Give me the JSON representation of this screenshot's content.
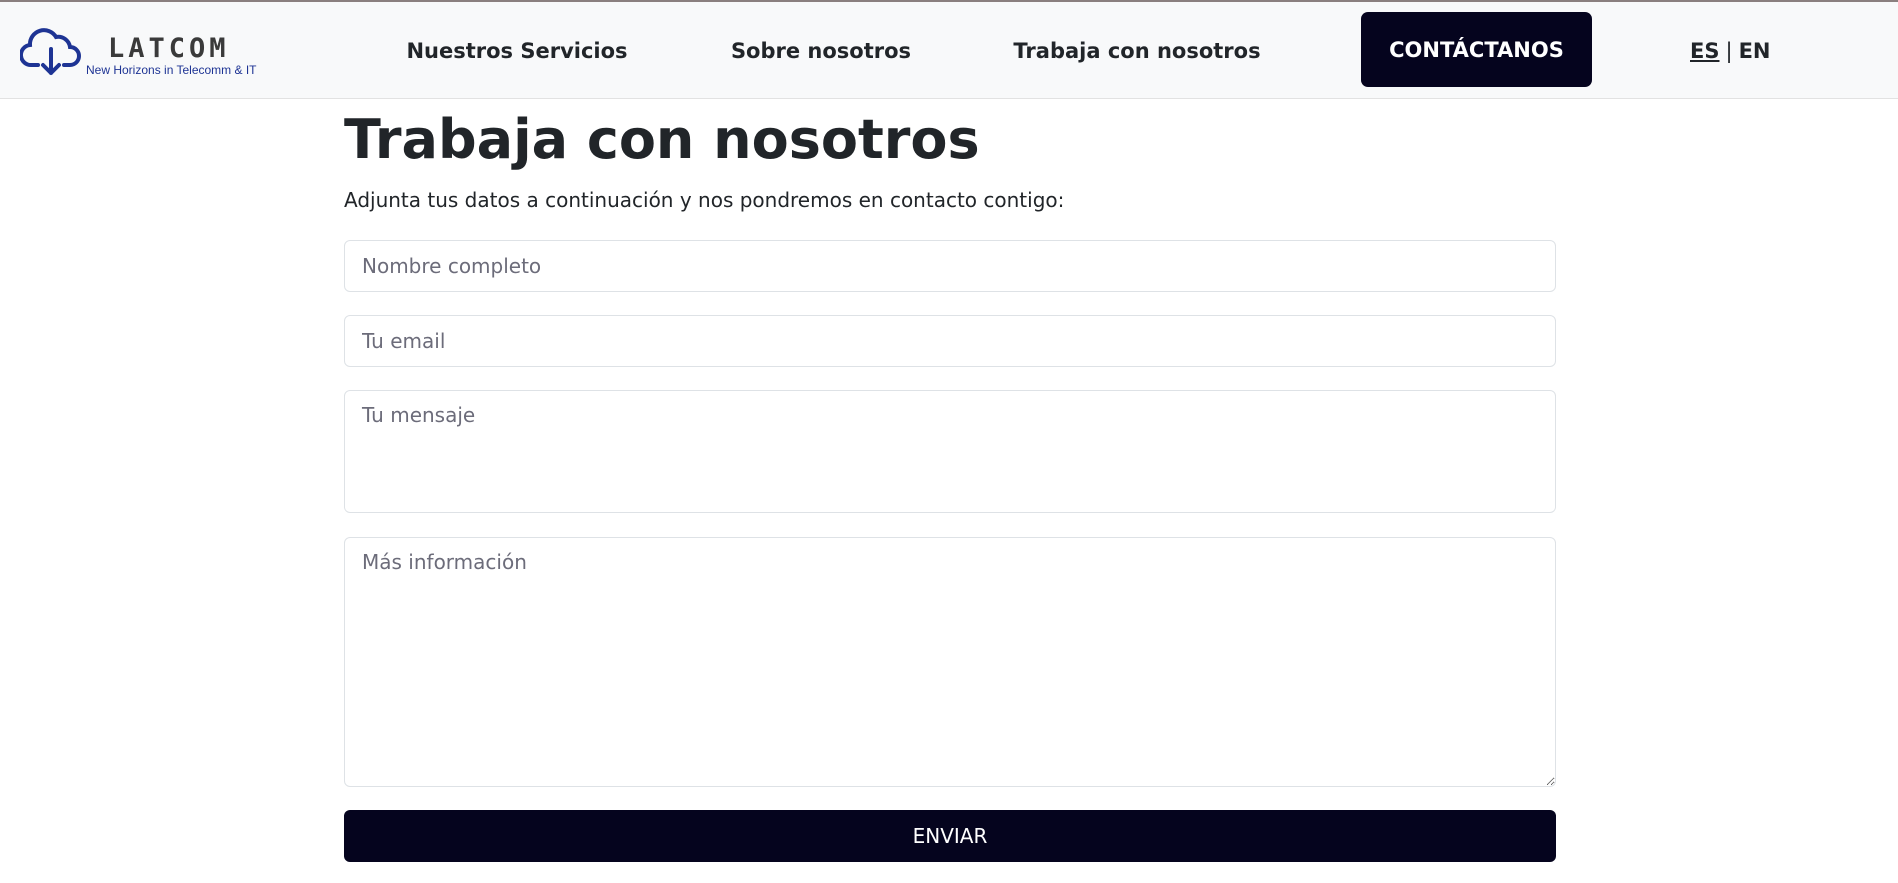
{
  "brand": {
    "name": "LATCOM",
    "tagline": "New Horizons in Telecomm & IT",
    "icon": "cloud-download-icon",
    "color": "#1e3494"
  },
  "nav": {
    "items": [
      {
        "label": "Nuestros Servicios"
      },
      {
        "label": "Sobre nosotros"
      },
      {
        "label": "Trabaja con nosotros"
      }
    ],
    "cta": "CONTÁCTANOS",
    "lang": {
      "es": "ES",
      "sep": "|",
      "en": "EN"
    }
  },
  "page": {
    "title": "Trabaja con nosotros",
    "subtitle": "Adjunta tus datos a continuación y nos pondremos en contacto contigo:"
  },
  "form": {
    "name_placeholder": "Nombre completo",
    "email_placeholder": "Tu email",
    "message_placeholder": "Tu mensaje",
    "info_placeholder": "Más información",
    "submit": "ENVIAR"
  },
  "colors": {
    "primary": "#05041e",
    "header_bg": "#f8f9fa"
  }
}
